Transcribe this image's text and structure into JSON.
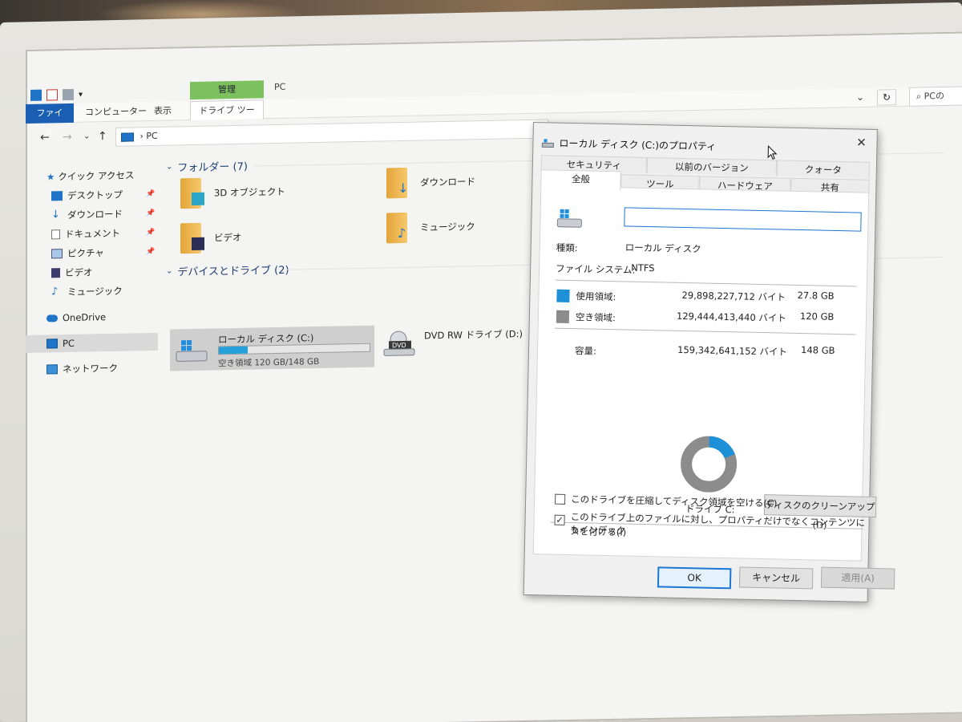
{
  "explorer": {
    "ribbon": {
      "tabs": [
        "ファイル",
        "コンピューター",
        "表示"
      ],
      "context_header": "管理",
      "context_tab": "ドライブ ツール",
      "window_title": "PC",
      "search_placeholder": "PCの"
    },
    "address": {
      "path": "PC"
    },
    "nav": {
      "quick_access": "クイック アクセス",
      "items": [
        "デスクトップ",
        "ダウンロード",
        "ドキュメント",
        "ピクチャ",
        "ビデオ",
        "ミュージック"
      ],
      "onedrive": "OneDrive",
      "pc": "PC",
      "network": "ネットワーク"
    },
    "folders_group": "フォルダー (7)",
    "folders": [
      "3D オブジェクト",
      "ダウンロード",
      "ビデオ",
      "ミュージック"
    ],
    "drives_group": "デバイスとドライブ (2)",
    "local_disk": {
      "name": "ローカル ディスク (C:)",
      "free_text": "空き領域 120 GB/148 GB",
      "used_fraction": 0.19
    },
    "dvd": {
      "name": "DVD RW ドライブ (D:)",
      "label": "DVD"
    }
  },
  "dialog": {
    "title": "ローカル ディスク (C:)のプロパティ",
    "tabs_row1": [
      "セキュリティ",
      "以前のバージョン",
      "クォータ"
    ],
    "tabs_row2": [
      "全般",
      "ツール",
      "ハードウェア",
      "共有"
    ],
    "active_tab": "全般",
    "name_value": "",
    "type_label": "種類:",
    "type_value": "ローカル ディスク",
    "fs_label": "ファイル システム:",
    "fs_value": "NTFS",
    "used_label": "使用領域:",
    "used_bytes": "29,898,227,712 バイト",
    "used_size": "27.8 GB",
    "free_label": "空き領域:",
    "free_bytes": "129,444,413,440 バイト",
    "free_size": "120 GB",
    "capacity_label": "容量:",
    "capacity_bytes": "159,342,641,152 バイト",
    "capacity_size": "148 GB",
    "drive_label": "ドライブ C:",
    "cleanup_button": "ディスクのクリーンアップ(D)",
    "compress_label": "このドライブを圧縮してディスク領域を空ける(C)",
    "compress_checked": false,
    "index_label_1": "このドライブ上のファイルに対し、プロパティだけでなくコンテンツにもインデック",
    "index_label_2": "スを付ける(I)",
    "index_checked": true,
    "ok": "OK",
    "cancel": "キャンセル",
    "apply": "適用(A)",
    "used_fraction": 0.188,
    "colors": {
      "used": "#1e90d8",
      "free": "#8c8c8c",
      "accent": "#1b77d2"
    }
  }
}
